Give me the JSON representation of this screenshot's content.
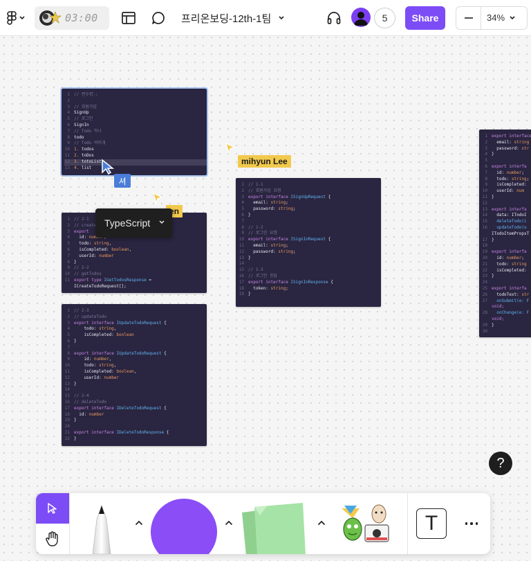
{
  "app": {
    "timer": "03:00",
    "file_title": "프리온보딩-12th-1팀",
    "collaborator_count": "5",
    "share_label": "Share",
    "zoom": "34%",
    "zoom_minus": "—"
  },
  "canvas": {
    "cursor_tags": [
      "mihyun Lee",
      "en"
    ],
    "ime_chip": "셔",
    "language_menu": {
      "selected": "TypeScript"
    },
    "help_label": "?"
  },
  "cards": {
    "card1": [
      {
        "n": "1",
        "parts": [
          [
            "// 변수명::",
            "c"
          ]
        ]
      },
      {
        "n": "2",
        "parts": []
      },
      {
        "n": "3",
        "parts": [
          [
            "// 회원가입",
            "c"
          ]
        ]
      },
      {
        "n": "4",
        "parts": [
          [
            "SignUp",
            "p"
          ]
        ]
      },
      {
        "n": "5",
        "parts": [
          [
            "// 로그인",
            "c"
          ]
        ]
      },
      {
        "n": "6",
        "parts": [
          [
            "SignIn",
            "p"
          ]
        ]
      },
      {
        "n": "7",
        "parts": [
          [
            "// Todo 하나",
            "c"
          ]
        ]
      },
      {
        "n": "8",
        "parts": [
          [
            "todo",
            "p"
          ]
        ]
      },
      {
        "n": "9",
        "parts": [
          [
            "// Todo 여러개",
            "c"
          ]
        ]
      },
      {
        "n": "10",
        "parts": [
          [
            "1.",
            "t"
          ],
          [
            " todos",
            "p"
          ]
        ]
      },
      {
        "n": "11",
        "parts": [
          [
            "2.",
            "t"
          ],
          [
            " toDos",
            "p"
          ]
        ]
      },
      {
        "n": "12",
        "parts": [
          [
            "3.",
            "t"
          ],
          [
            " totoList",
            "p"
          ]
        ],
        "hl": true
      },
      {
        "n": "13",
        "parts": [
          [
            "4.",
            "t"
          ],
          [
            " list",
            "p"
          ]
        ]
      }
    ],
    "card2": [
      {
        "n": "1",
        "parts": [
          [
            "// 2-1",
            "c"
          ]
        ]
      },
      {
        "n": "2",
        "parts": [
          [
            "// createTodo",
            "c"
          ]
        ]
      },
      {
        "n": "3",
        "parts": [
          [
            "export",
            "k"
          ]
        ]
      },
      {
        "n": "4",
        "parts": [
          [
            "  id: ",
            "p"
          ],
          [
            "number",
            "t"
          ],
          [
            ";",
            "p"
          ]
        ]
      },
      {
        "n": "5",
        "parts": [
          [
            "  todo: ",
            "p"
          ],
          [
            "string",
            "t"
          ],
          [
            ",",
            "p"
          ]
        ]
      },
      {
        "n": "6",
        "parts": [
          [
            "  isCompleted: ",
            "p"
          ],
          [
            "boolean",
            "t"
          ],
          [
            ",",
            "p"
          ]
        ]
      },
      {
        "n": "7",
        "parts": [
          [
            "  userId: ",
            "p"
          ],
          [
            "number",
            "t"
          ]
        ]
      },
      {
        "n": "8",
        "parts": [
          [
            "}",
            "p"
          ]
        ]
      },
      {
        "n": "9",
        "parts": [
          [
            "// 2-2",
            "c"
          ]
        ]
      },
      {
        "n": "10",
        "parts": [
          [
            "// getTodos",
            "c"
          ]
        ]
      },
      {
        "n": "11",
        "parts": [
          [
            "export ",
            "k"
          ],
          [
            "type ",
            "k"
          ],
          [
            "IGetTodosResponse",
            "n"
          ],
          [
            " =",
            "p"
          ]
        ]
      },
      {
        "n": "",
        "parts": [
          [
            "ICreateTodoRequest[];",
            "p"
          ]
        ]
      }
    ],
    "card3": [
      {
        "n": "1",
        "parts": [
          [
            "// 2-3",
            "c"
          ]
        ]
      },
      {
        "n": "2",
        "parts": [
          [
            "// updateTodo",
            "c"
          ]
        ]
      },
      {
        "n": "3",
        "parts": [
          [
            "export ",
            "k"
          ],
          [
            "interface ",
            "k"
          ],
          [
            "IUpdateTodoRequest",
            "n"
          ],
          [
            " {",
            "p"
          ]
        ]
      },
      {
        "n": "4",
        "parts": [
          [
            "    todo: ",
            "p"
          ],
          [
            "string",
            "t"
          ],
          [
            ",",
            "p"
          ]
        ]
      },
      {
        "n": "5",
        "parts": [
          [
            "    isCompleted: ",
            "p"
          ],
          [
            "boolean",
            "t"
          ]
        ]
      },
      {
        "n": "6",
        "parts": [
          [
            "}",
            "p"
          ]
        ]
      },
      {
        "n": "7",
        "parts": []
      },
      {
        "n": "8",
        "parts": [
          [
            "export ",
            "k"
          ],
          [
            "interface ",
            "k"
          ],
          [
            "IUpdateTodoRequest",
            "n"
          ],
          [
            " {",
            "p"
          ]
        ]
      },
      {
        "n": "9",
        "parts": [
          [
            "    id: ",
            "p"
          ],
          [
            "number",
            "t"
          ],
          [
            ",",
            "p"
          ]
        ]
      },
      {
        "n": "10",
        "parts": [
          [
            "    todo: ",
            "p"
          ],
          [
            "string",
            "t"
          ],
          [
            ",",
            "p"
          ]
        ]
      },
      {
        "n": "11",
        "parts": [
          [
            "    isCompleted: ",
            "p"
          ],
          [
            "boolean",
            "t"
          ],
          [
            ",",
            "p"
          ]
        ]
      },
      {
        "n": "12",
        "parts": [
          [
            "    userId: ",
            "p"
          ],
          [
            "number",
            "t"
          ]
        ]
      },
      {
        "n": "13",
        "parts": [
          [
            "}",
            "p"
          ]
        ]
      },
      {
        "n": "14",
        "parts": []
      },
      {
        "n": "15",
        "parts": [
          [
            "// 2-4",
            "c"
          ]
        ]
      },
      {
        "n": "16",
        "parts": [
          [
            "// deleteTodo",
            "c"
          ]
        ]
      },
      {
        "n": "17",
        "parts": [
          [
            "export ",
            "k"
          ],
          [
            "interface ",
            "k"
          ],
          [
            "IDeleteTodoRequest",
            "n"
          ],
          [
            " {",
            "p"
          ]
        ]
      },
      {
        "n": "18",
        "parts": [
          [
            "  id: ",
            "p"
          ],
          [
            "number",
            "t"
          ]
        ]
      },
      {
        "n": "19",
        "parts": [
          [
            "}",
            "p"
          ]
        ]
      },
      {
        "n": "20",
        "parts": []
      },
      {
        "n": "21",
        "parts": [
          [
            "export ",
            "k"
          ],
          [
            "interface ",
            "k"
          ],
          [
            "IDeleteTodoResponse",
            "n"
          ],
          [
            " {",
            "p"
          ]
        ]
      },
      {
        "n": "22",
        "parts": [
          [
            "}",
            "p"
          ]
        ]
      }
    ],
    "card4": [
      {
        "n": "1",
        "parts": [
          [
            "// 1-1",
            "c"
          ]
        ]
      },
      {
        "n": "2",
        "parts": [
          [
            "// 회원가입 요청",
            "c"
          ]
        ]
      },
      {
        "n": "3",
        "parts": [
          [
            "export ",
            "k"
          ],
          [
            "interface ",
            "k"
          ],
          [
            "ISignUpRequest",
            "n"
          ],
          [
            " {",
            "p"
          ]
        ]
      },
      {
        "n": "4",
        "parts": [
          [
            "  email: ",
            "p"
          ],
          [
            "string",
            "t"
          ],
          [
            ";",
            "p"
          ]
        ]
      },
      {
        "n": "5",
        "parts": [
          [
            "  password: ",
            "p"
          ],
          [
            "string",
            "t"
          ],
          [
            ";",
            "p"
          ]
        ]
      },
      {
        "n": "6",
        "parts": [
          [
            "}",
            "p"
          ]
        ]
      },
      {
        "n": "7",
        "parts": []
      },
      {
        "n": "8",
        "parts": [
          [
            "// 1-2",
            "c"
          ]
        ]
      },
      {
        "n": "9",
        "parts": [
          [
            "// 로그인 요청",
            "c"
          ]
        ]
      },
      {
        "n": "10",
        "parts": [
          [
            "export ",
            "k"
          ],
          [
            "interface ",
            "k"
          ],
          [
            "ISignInRequest",
            "n"
          ],
          [
            " {",
            "p"
          ]
        ]
      },
      {
        "n": "11",
        "parts": [
          [
            "  email: ",
            "p"
          ],
          [
            "string",
            "t"
          ],
          [
            ";",
            "p"
          ]
        ]
      },
      {
        "n": "12",
        "parts": [
          [
            "  password: ",
            "p"
          ],
          [
            "string",
            "t"
          ],
          [
            ";",
            "p"
          ]
        ]
      },
      {
        "n": "13",
        "parts": [
          [
            "}",
            "p"
          ]
        ]
      },
      {
        "n": "14",
        "parts": []
      },
      {
        "n": "15",
        "parts": [
          [
            "// 1-3",
            "c"
          ]
        ]
      },
      {
        "n": "16",
        "parts": [
          [
            "// 로그인 응답",
            "c"
          ]
        ]
      },
      {
        "n": "17",
        "parts": [
          [
            "export ",
            "k"
          ],
          [
            "interface ",
            "k"
          ],
          [
            "ISignInResponse",
            "n"
          ],
          [
            " {",
            "p"
          ]
        ]
      },
      {
        "n": "18",
        "parts": [
          [
            "  token: ",
            "p"
          ],
          [
            "string",
            "t"
          ],
          [
            ";",
            "p"
          ]
        ]
      },
      {
        "n": "19",
        "parts": [
          [
            "}",
            "p"
          ]
        ]
      }
    ],
    "card5": [
      {
        "n": "1",
        "parts": [
          [
            "export ",
            "k"
          ],
          [
            "interface",
            "k"
          ]
        ]
      },
      {
        "n": "2",
        "parts": [
          [
            "  email: ",
            "p"
          ],
          [
            "string",
            "t"
          ]
        ]
      },
      {
        "n": "3",
        "parts": [
          [
            "  password: ",
            "p"
          ],
          [
            "str",
            "t"
          ]
        ]
      },
      {
        "n": "4",
        "parts": [
          [
            "}",
            "p"
          ]
        ]
      },
      {
        "n": "5",
        "parts": []
      },
      {
        "n": "6",
        "parts": [
          [
            "export ",
            "k"
          ],
          [
            "interfa",
            "k"
          ]
        ]
      },
      {
        "n": "7",
        "parts": [
          [
            "  id: ",
            "p"
          ],
          [
            "number",
            "t"
          ],
          [
            ";",
            "p"
          ]
        ]
      },
      {
        "n": "8",
        "parts": [
          [
            "  todo: ",
            "p"
          ],
          [
            "string",
            "t"
          ],
          [
            ";",
            "p"
          ]
        ]
      },
      {
        "n": "9",
        "parts": [
          [
            "  isCompleted:",
            "p"
          ]
        ]
      },
      {
        "n": "10",
        "parts": [
          [
            "  userId: ",
            "p"
          ],
          [
            "num",
            "t"
          ]
        ]
      },
      {
        "n": "11",
        "parts": [
          [
            "}",
            "p"
          ]
        ]
      },
      {
        "n": "12",
        "parts": []
      },
      {
        "n": "13",
        "parts": [
          [
            "export ",
            "k"
          ],
          [
            "interfa",
            "k"
          ]
        ]
      },
      {
        "n": "14",
        "parts": [
          [
            "  data: ITodoI",
            "p"
          ]
        ]
      },
      {
        "n": "15",
        "parts": [
          [
            "  deleteTodo(i",
            "n"
          ]
        ]
      },
      {
        "n": "16",
        "parts": [
          [
            "  updateTodo(u",
            "n"
          ]
        ]
      },
      {
        "n": "",
        "parts": [
          [
            "ITodoItemPropsT",
            "p"
          ]
        ]
      },
      {
        "n": "17",
        "parts": [
          [
            "}",
            "p"
          ]
        ]
      },
      {
        "n": "18",
        "parts": []
      },
      {
        "n": "19",
        "parts": [
          [
            "export ",
            "k"
          ],
          [
            "interfa",
            "k"
          ]
        ]
      },
      {
        "n": "20",
        "parts": [
          [
            "  id: ",
            "p"
          ],
          [
            "number",
            "t"
          ],
          [
            ";",
            "p"
          ]
        ]
      },
      {
        "n": "21",
        "parts": [
          [
            "  todo: ",
            "p"
          ],
          [
            "string",
            "t"
          ]
        ]
      },
      {
        "n": "22",
        "parts": [
          [
            "  isCompleted:",
            "p"
          ]
        ]
      },
      {
        "n": "23",
        "parts": [
          [
            "}",
            "p"
          ]
        ]
      },
      {
        "n": "24",
        "parts": []
      },
      {
        "n": "25",
        "parts": [
          [
            "export ",
            "k"
          ],
          [
            "interfa",
            "k"
          ]
        ]
      },
      {
        "n": "26",
        "parts": [
          [
            "  todoText: ",
            "p"
          ],
          [
            "str",
            "t"
          ]
        ]
      },
      {
        "n": "27",
        "parts": [
          [
            "  onSubmit(e: F",
            "n"
          ]
        ]
      },
      {
        "n": "",
        "parts": [
          [
            "void;",
            "k"
          ]
        ]
      },
      {
        "n": "28",
        "parts": [
          [
            "  onChange(e: F",
            "n"
          ]
        ]
      },
      {
        "n": "",
        "parts": [
          [
            "void;",
            "k"
          ]
        ]
      },
      {
        "n": "29",
        "parts": [
          [
            "}",
            "p"
          ]
        ]
      },
      {
        "n": "30",
        "parts": []
      }
    ]
  },
  "toolbar": {
    "text_tool_label": "T"
  },
  "colors": {
    "accent": "#7c4cf6",
    "card_bg": "#2a2540",
    "name_tag": "#f2c94c",
    "shape_tool": "#8a4df6",
    "sticky": "#a6e3a6"
  },
  "icons": [
    "figma-icon",
    "chevron-down-icon",
    "layout-icon",
    "comment-icon",
    "headset-icon",
    "avatar-icon",
    "minus-icon",
    "move-cursor-icon",
    "hand-icon",
    "pen-icon",
    "caret-up-icon",
    "sticky-note-icon",
    "stamp-icon",
    "text-icon",
    "more-icon",
    "help-icon"
  ]
}
